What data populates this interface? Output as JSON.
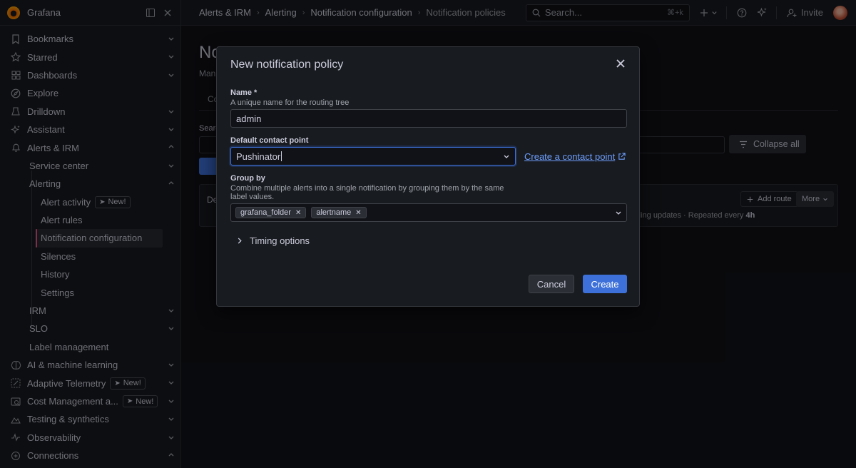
{
  "app": {
    "name": "Grafana"
  },
  "topbar": {
    "breadcrumbs": [
      "Alerts & IRM",
      "Alerting",
      "Notification configuration",
      "Notification policies"
    ],
    "search_placeholder": "Search...",
    "search_shortcut": "⌘+k",
    "invite_label": "Invite"
  },
  "sidebar": {
    "items": [
      {
        "label": "Bookmarks",
        "icon": "bookmark-icon"
      },
      {
        "label": "Starred",
        "icon": "star-icon"
      },
      {
        "label": "Dashboards",
        "icon": "dashboards-icon"
      },
      {
        "label": "Explore",
        "icon": "compass-icon"
      },
      {
        "label": "Drilldown",
        "icon": "drilldown-icon"
      },
      {
        "label": "Assistant",
        "icon": "sparkle-icon"
      },
      {
        "label": "Alerts & IRM",
        "icon": "bell-icon"
      },
      {
        "label": "Service center"
      },
      {
        "label": "Alerting"
      },
      {
        "label": "Alert activity",
        "badge": "New!"
      },
      {
        "label": "Alert rules"
      },
      {
        "label": "Notification configuration"
      },
      {
        "label": "Silences"
      },
      {
        "label": "History"
      },
      {
        "label": "Settings"
      },
      {
        "label": "IRM"
      },
      {
        "label": "SLO"
      },
      {
        "label": "Label management"
      },
      {
        "label": "AI & machine learning",
        "icon": "brain-icon"
      },
      {
        "label": "Adaptive Telemetry",
        "icon": "adaptive-icon",
        "badge": "New!"
      },
      {
        "label": "Cost Management a...",
        "icon": "cost-icon",
        "badge": "New!"
      },
      {
        "label": "Testing & synthetics",
        "icon": "synthetics-icon"
      },
      {
        "label": "Observability",
        "icon": "observability-icon"
      },
      {
        "label": "Connections",
        "icon": "connections-icon"
      }
    ]
  },
  "background": {
    "title": "No",
    "subtitle": "Man",
    "tab": "Co",
    "search_label": "Searc",
    "collapse_all": "Collapse all",
    "card_title": "De",
    "add_route": "Add route",
    "more": "More",
    "meta_text": "ding updates · Repeated every ",
    "meta_value": "4h"
  },
  "modal": {
    "title": "New notification policy",
    "name_label": "Name *",
    "name_desc": "A unique name for the routing tree",
    "name_value": "admin",
    "contact_label": "Default contact point",
    "contact_value": "Pushinator",
    "create_contact_link": "Create a contact point",
    "group_label": "Group by",
    "group_desc_1": "Combine multiple alerts into a single notification by grouping them by the same",
    "group_desc_2": "label values.",
    "group_chips": [
      "grafana_folder",
      "alertname"
    ],
    "timing_label": "Timing options",
    "cancel_label": "Cancel",
    "create_label": "Create"
  },
  "colors": {
    "primary": "#3d71d9",
    "link": "#6e9fff",
    "active_indicator": "#e8567e"
  }
}
